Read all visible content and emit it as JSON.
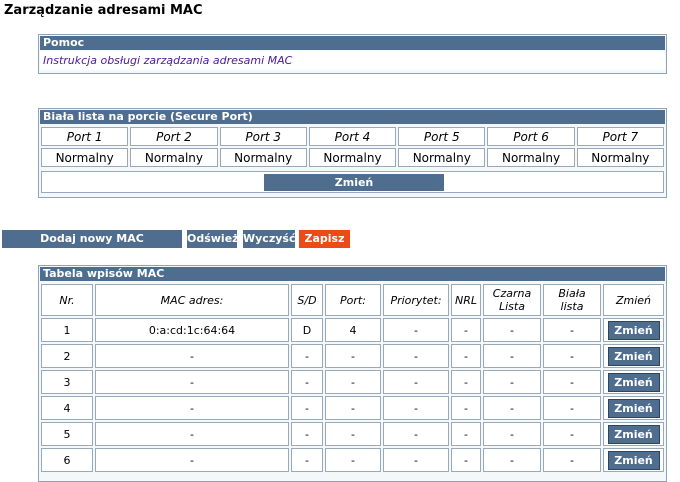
{
  "page_title": "Zarządzanie adresami MAC",
  "help": {
    "header": "Pomoc",
    "link_text": "Instrukcja obsługi zarządzania adresami MAC"
  },
  "secure_port": {
    "header": "Biała lista na porcie (Secure Port)",
    "ports": [
      {
        "label": "Port 1",
        "value": "Normalny"
      },
      {
        "label": "Port 2",
        "value": "Normalny"
      },
      {
        "label": "Port 3",
        "value": "Normalny"
      },
      {
        "label": "Port 4",
        "value": "Normalny"
      },
      {
        "label": "Port 5",
        "value": "Normalny"
      },
      {
        "label": "Port 6",
        "value": "Normalny"
      },
      {
        "label": "Port 7",
        "value": "Normalny"
      }
    ],
    "change_button": "Zmień"
  },
  "actions": {
    "add_mac": "Dodaj nowy MAC",
    "refresh": "Odśwież",
    "clear": "Wyczyść",
    "save": "Zapisz"
  },
  "mac_table": {
    "header": "Tabela wpisów MAC",
    "columns": {
      "nr": "Nr.",
      "mac": "MAC adres:",
      "sd": "S/D",
      "port": "Port:",
      "priority": "Priorytet:",
      "nrl": "NRL",
      "blacklist_1": "Czarna",
      "blacklist_2": "Lista",
      "whitelist_1": "Biała",
      "whitelist_2": "lista",
      "change": "Zmień"
    },
    "rows": [
      {
        "nr": "1",
        "mac": "0:a:cd:1c:64:64",
        "sd": "D",
        "port": "4",
        "priority": "-",
        "nrl": "-",
        "black": "-",
        "white": "-",
        "btn": "Zmień"
      },
      {
        "nr": "2",
        "mac": "-",
        "sd": "-",
        "port": "-",
        "priority": "-",
        "nrl": "-",
        "black": "-",
        "white": "-",
        "btn": "Zmień"
      },
      {
        "nr": "3",
        "mac": "-",
        "sd": "-",
        "port": "-",
        "priority": "-",
        "nrl": "-",
        "black": "-",
        "white": "-",
        "btn": "Zmień"
      },
      {
        "nr": "4",
        "mac": "-",
        "sd": "-",
        "port": "-",
        "priority": "-",
        "nrl": "-",
        "black": "-",
        "white": "-",
        "btn": "Zmień"
      },
      {
        "nr": "5",
        "mac": "-",
        "sd": "-",
        "port": "-",
        "priority": "-",
        "nrl": "-",
        "black": "-",
        "white": "-",
        "btn": "Zmień"
      },
      {
        "nr": "6",
        "mac": "-",
        "sd": "-",
        "port": "-",
        "priority": "-",
        "nrl": "-",
        "black": "-",
        "white": "-",
        "btn": "Zmień"
      }
    ]
  },
  "colors": {
    "header_bg": "#4f6e8f",
    "save_bg": "#ec4a17",
    "link": "#4a1a96"
  }
}
